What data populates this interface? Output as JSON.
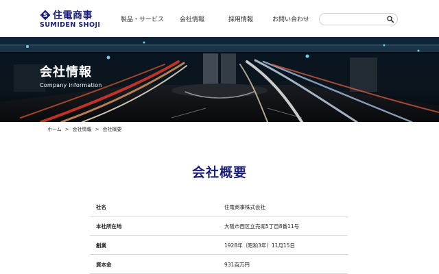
{
  "header": {
    "logo_jp": "住電商事",
    "logo_en": "SUMIDEN SHOJI",
    "nav": [
      {
        "label": "製品・サービス"
      },
      {
        "label": "会社情報"
      },
      {
        "label": "採用情報"
      },
      {
        "label": "お問い合わせ"
      }
    ],
    "search": {
      "placeholder": "",
      "value": ""
    }
  },
  "hero": {
    "title": "会社情報",
    "subtitle": "Company information"
  },
  "breadcrumb": [
    "ホーム",
    "会社情報",
    "会社概要"
  ],
  "page_title": "会社概要",
  "company_table": [
    {
      "label": "社名",
      "value": "住電商事株式会社"
    },
    {
      "label": "本社所在地",
      "value": "大阪市西区立売堀5丁目8番11号"
    },
    {
      "label": "創業",
      "value": "1928年（昭和3年）11月15日"
    },
    {
      "label": "資本金",
      "value": "931百万円"
    }
  ],
  "colors": {
    "brand": "#1b1f7a",
    "hero_bg": "#0a1420",
    "divider": "#d9d9d9"
  },
  "icons": {
    "logo": "sumiden-logo-icon",
    "search": "search-icon"
  }
}
